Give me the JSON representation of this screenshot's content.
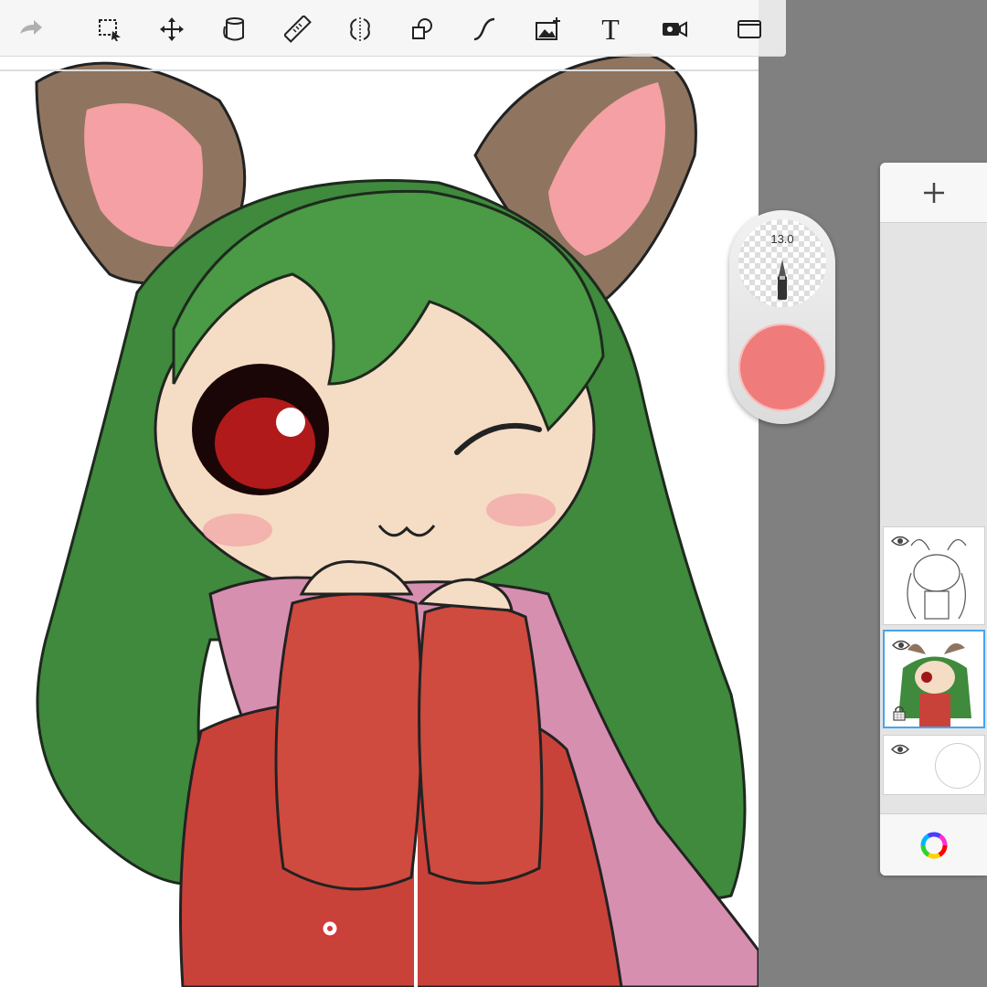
{
  "toolbar": {
    "tools": [
      {
        "name": "redo-icon"
      },
      {
        "name": "selection-icon"
      },
      {
        "name": "transform-icon"
      },
      {
        "name": "fill-icon"
      },
      {
        "name": "ruler-icon"
      },
      {
        "name": "symmetry-icon"
      },
      {
        "name": "shapes-icon"
      },
      {
        "name": "curve-icon"
      },
      {
        "name": "import-image-icon"
      },
      {
        "name": "text-icon",
        "label": "T"
      },
      {
        "name": "record-video-icon"
      },
      {
        "name": "fullscreen-icon"
      }
    ]
  },
  "brush_puck": {
    "size_label": "13.0",
    "current_color": "#f07b7b"
  },
  "layers": {
    "add_icon": "plus-icon",
    "items": [
      {
        "name": "layer-sketch",
        "visible": true,
        "selected": false,
        "locked": false
      },
      {
        "name": "layer-color",
        "visible": true,
        "selected": true,
        "locked": true
      },
      {
        "name": "layer-background",
        "visible": true,
        "selected": false,
        "locked": false
      }
    ],
    "color_editor_icon": "color-wheel-icon"
  },
  "colors": {
    "selection": "#46a4f0",
    "workspace": "#808080"
  }
}
